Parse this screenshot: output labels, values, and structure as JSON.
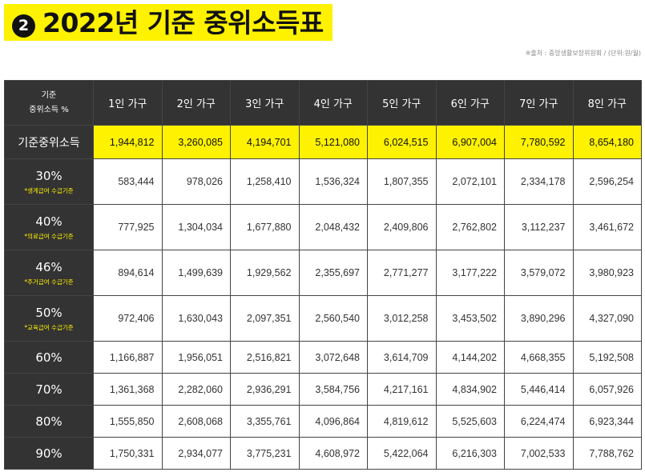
{
  "header": {
    "badge": "2",
    "title": "2022년 기준 중위소득표",
    "source": "※출처 : 중앙생활보장위원회 / (단위:원/월)"
  },
  "table": {
    "corner_line1": "기준",
    "corner_line2": "중위소득 %",
    "columns": [
      "1인 가구",
      "2인 가구",
      "3인 가구",
      "4인 가구",
      "5인 가구",
      "6인 가구",
      "7인 가구",
      "8인 가구"
    ],
    "base_row": {
      "label": "기준중위소득",
      "values": [
        "1,944,812",
        "3,260,085",
        "4,194,701",
        "5,121,080",
        "6,024,515",
        "6,907,004",
        "7,780,592",
        "8,654,180"
      ]
    },
    "rows": [
      {
        "label": "30%",
        "sub": "*생계급여 수급기준",
        "values": [
          "583,444",
          "978,026",
          "1,258,410",
          "1,536,324",
          "1,807,355",
          "2,072,101",
          "2,334,178",
          "2,596,254"
        ]
      },
      {
        "label": "40%",
        "sub": "*의료급여 수급기준",
        "values": [
          "777,925",
          "1,304,034",
          "1,677,880",
          "2,048,432",
          "2,409,806",
          "2,762,802",
          "3,112,237",
          "3,461,672"
        ]
      },
      {
        "label": "46%",
        "sub": "*주거급여 수급기준",
        "values": [
          "894,614",
          "1,499,639",
          "1,929,562",
          "2,355,697",
          "2,771,277",
          "3,177,222",
          "3,579,072",
          "3,980,923"
        ]
      },
      {
        "label": "50%",
        "sub": "*교육급여 수급기준",
        "values": [
          "972,406",
          "1,630,043",
          "2,097,351",
          "2,560,540",
          "3,012,258",
          "3,453,502",
          "3,890,296",
          "4,327,090"
        ]
      },
      {
        "label": "60%",
        "values": [
          "1,166,887",
          "1,956,051",
          "2,516,821",
          "3,072,648",
          "3,614,709",
          "4,144,202",
          "4,668,355",
          "5,192,508"
        ]
      },
      {
        "label": "70%",
        "values": [
          "1,361,368",
          "2,282,060",
          "2,936,291",
          "3,584,756",
          "4,217,161",
          "4,834,902",
          "5,446,414",
          "6,057,926"
        ]
      },
      {
        "label": "80%",
        "values": [
          "1,555,850",
          "2,608,068",
          "3,355,761",
          "4,096,864",
          "4,819,612",
          "5,525,603",
          "6,224,474",
          "6,923,344"
        ]
      },
      {
        "label": "90%",
        "values": [
          "1,750,331",
          "2,934,077",
          "3,775,231",
          "4,608,972",
          "5,422,064",
          "6,216,303",
          "7,002,533",
          "7,788,762"
        ]
      }
    ]
  },
  "colors": {
    "highlight": "#fff200",
    "header_bg": "#333333",
    "text_dark": "#111111"
  }
}
